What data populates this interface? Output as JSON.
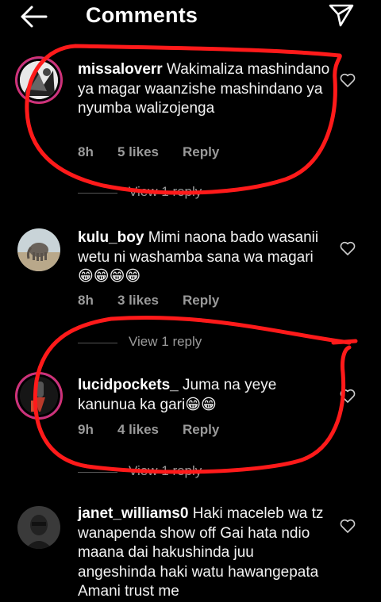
{
  "header": {
    "title": "Comments",
    "back_icon": "arrow-left-icon",
    "send_icon": "send-icon"
  },
  "colors": {
    "background": "#000000",
    "meta_text": "#9a9a9a",
    "annotation_red": "#ff0000",
    "story_ring": "#c13584"
  },
  "comments": [
    {
      "username": "missaloverr",
      "text": "Wakimaliza mashindano ya magar waanzishe mashindano ya nyumba walizojenga",
      "time": "8h",
      "likes": "5 likes",
      "reply": "Reply",
      "view_replies": "View 1 reply"
    },
    {
      "username": "kulu_boy",
      "text": "Mimi naona bado wasanii wetu ni washamba sana wa magari 😁😁😁😁",
      "time": "8h",
      "likes": "3 likes",
      "reply": "Reply",
      "view_replies": "View 1 reply"
    },
    {
      "username": "lucidpockets_",
      "text": "Juma na yeye kanunua ka gari😁😁",
      "time": "9h",
      "likes": "4 likes",
      "reply": "Reply",
      "view_replies": "View 1 reply"
    },
    {
      "username": "janet_williams0",
      "text": "Haki maceleb wa tz wanapenda show off Gai hata ndio maana dai hakushinda juu angeshinda haki watu hawangepata Amani trust me"
    }
  ]
}
